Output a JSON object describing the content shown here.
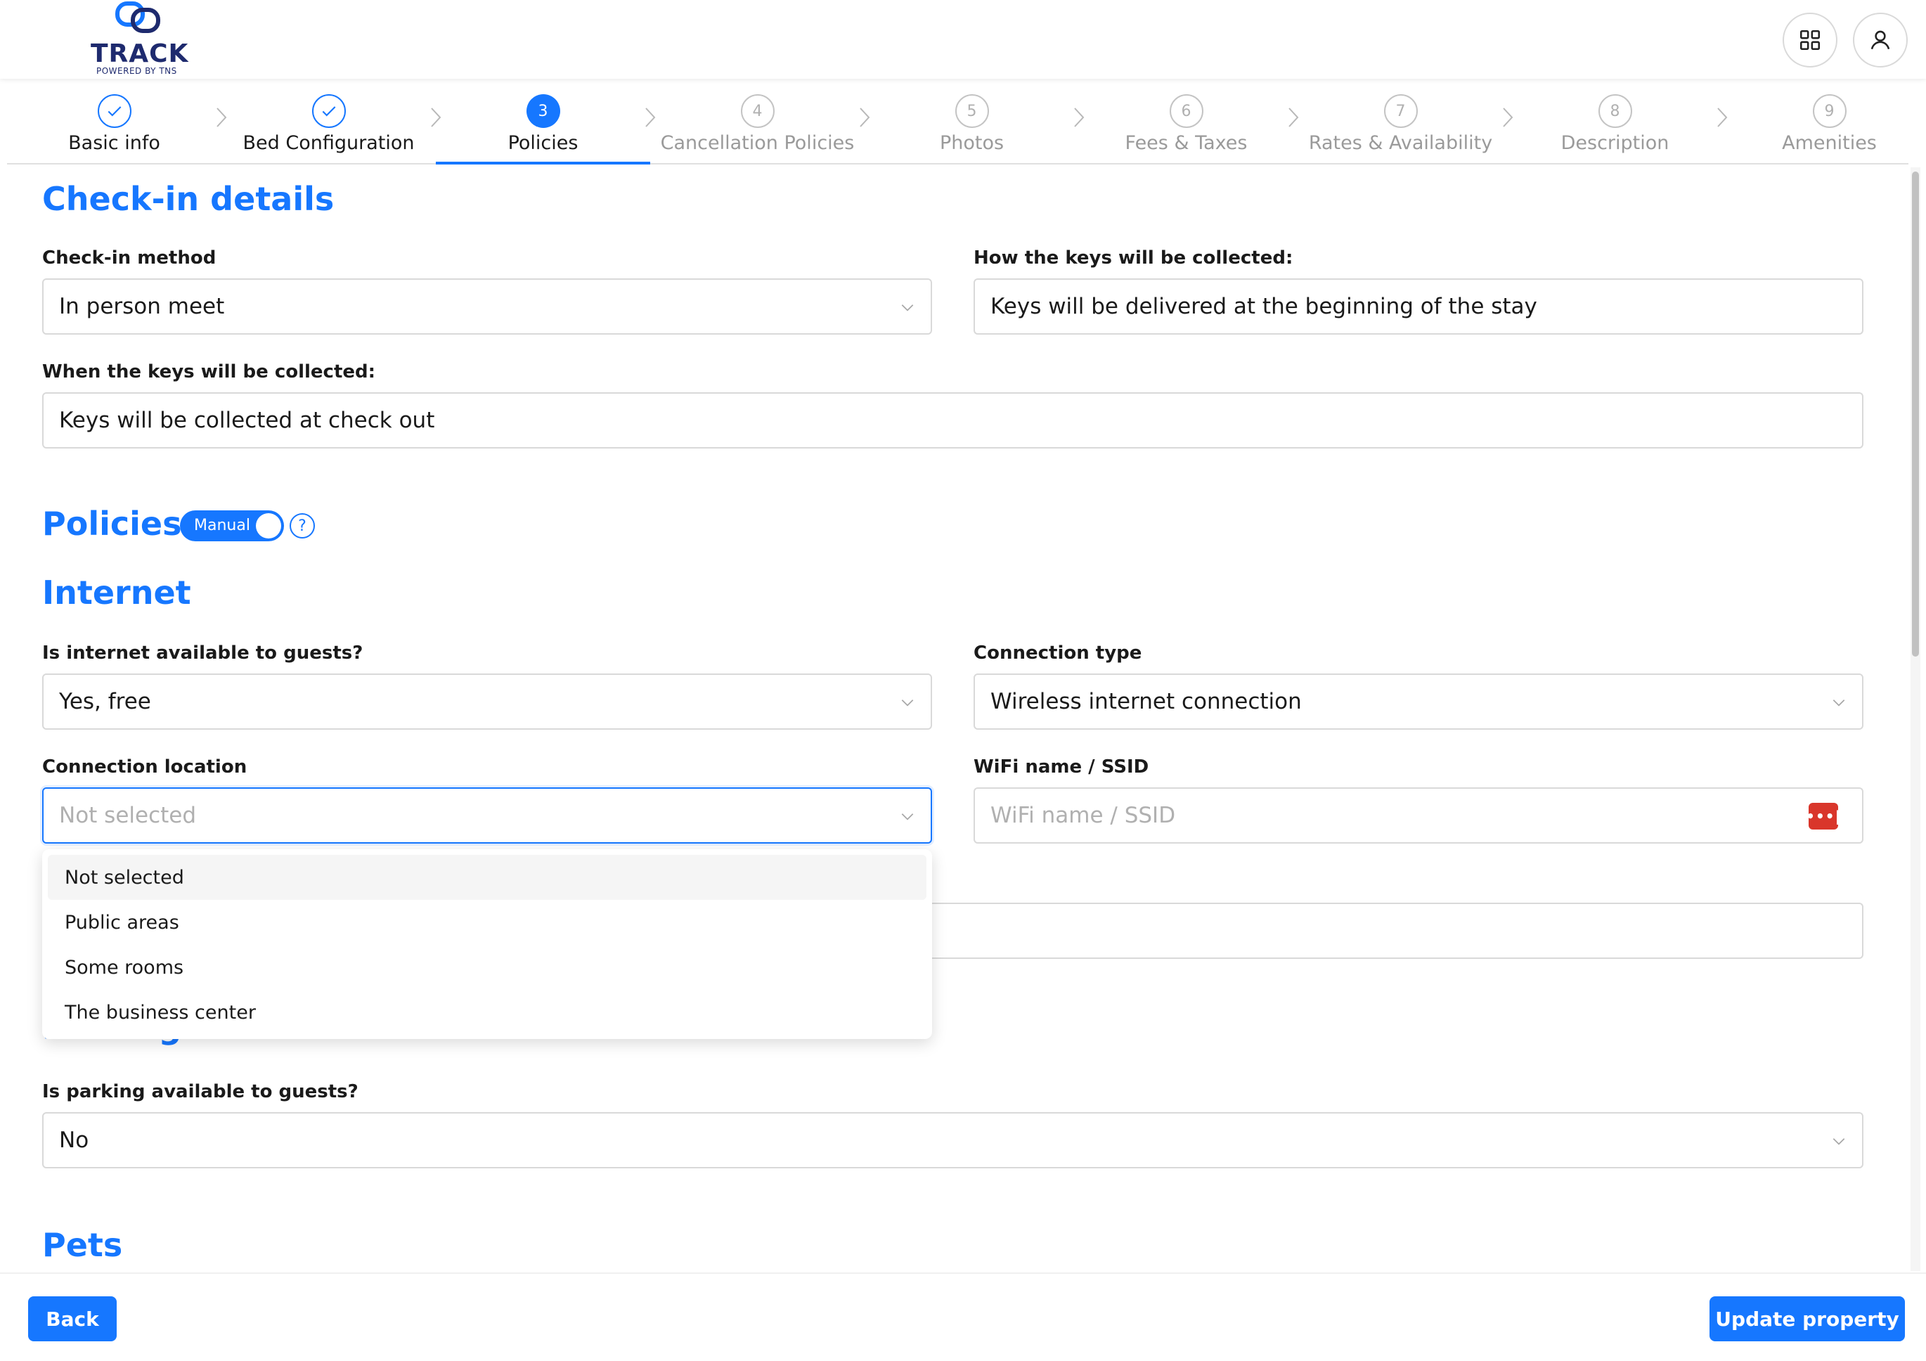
{
  "brand": {
    "name": "TRACK",
    "tagline": "POWERED BY TNS",
    "accent": "#1677ff",
    "logo_color": "#1e2a6e"
  },
  "header": {
    "apps_icon": "grid-icon",
    "user_icon": "user-icon"
  },
  "steps": [
    {
      "label": "Basic info",
      "state": "done",
      "num": ""
    },
    {
      "label": "Bed Configuration",
      "state": "done",
      "num": ""
    },
    {
      "label": "Policies",
      "state": "active",
      "num": "3"
    },
    {
      "label": "Cancellation Policies",
      "state": "todo",
      "num": "4"
    },
    {
      "label": "Photos",
      "state": "todo",
      "num": "5"
    },
    {
      "label": "Fees & Taxes",
      "state": "todo",
      "num": "6"
    },
    {
      "label": "Rates & Availability",
      "state": "todo",
      "num": "7"
    },
    {
      "label": "Description",
      "state": "todo",
      "num": "8"
    },
    {
      "label": "Amenities",
      "state": "todo",
      "num": "9"
    }
  ],
  "checkin": {
    "title": "Check-in details",
    "method_label": "Check-in method",
    "method_value": "In person meet",
    "keys_how_label": "How the keys will be collected:",
    "keys_how_value": "Keys will be delivered at the beginning of the stay",
    "keys_when_label": "When the keys will be collected:",
    "keys_when_value": "Keys will be collected at check out"
  },
  "policies": {
    "title": "Policies",
    "toggle_label": "Manual",
    "help": "?"
  },
  "internet": {
    "title": "Internet",
    "available_label": "Is internet available to guests?",
    "available_value": "Yes, free",
    "type_label": "Connection type",
    "type_value": "Wireless internet connection",
    "location_label": "Connection location",
    "location_value": "Not selected",
    "wifi_label": "WiFi name / SSID",
    "wifi_placeholder": "WiFi name / SSID",
    "pw_icon": "•••|"
  },
  "dropdown": {
    "options": [
      {
        "label": "Not selected",
        "selected": true
      },
      {
        "label": "Public areas",
        "selected": false
      },
      {
        "label": "Some rooms",
        "selected": false
      },
      {
        "label": "The business center",
        "selected": false
      }
    ]
  },
  "parking": {
    "title": "Parking",
    "available_label": "Is parking available to guests?",
    "available_value": "No"
  },
  "pets": {
    "title": "Pets"
  },
  "footer": {
    "back_label": "Back",
    "update_label": "Update property"
  }
}
